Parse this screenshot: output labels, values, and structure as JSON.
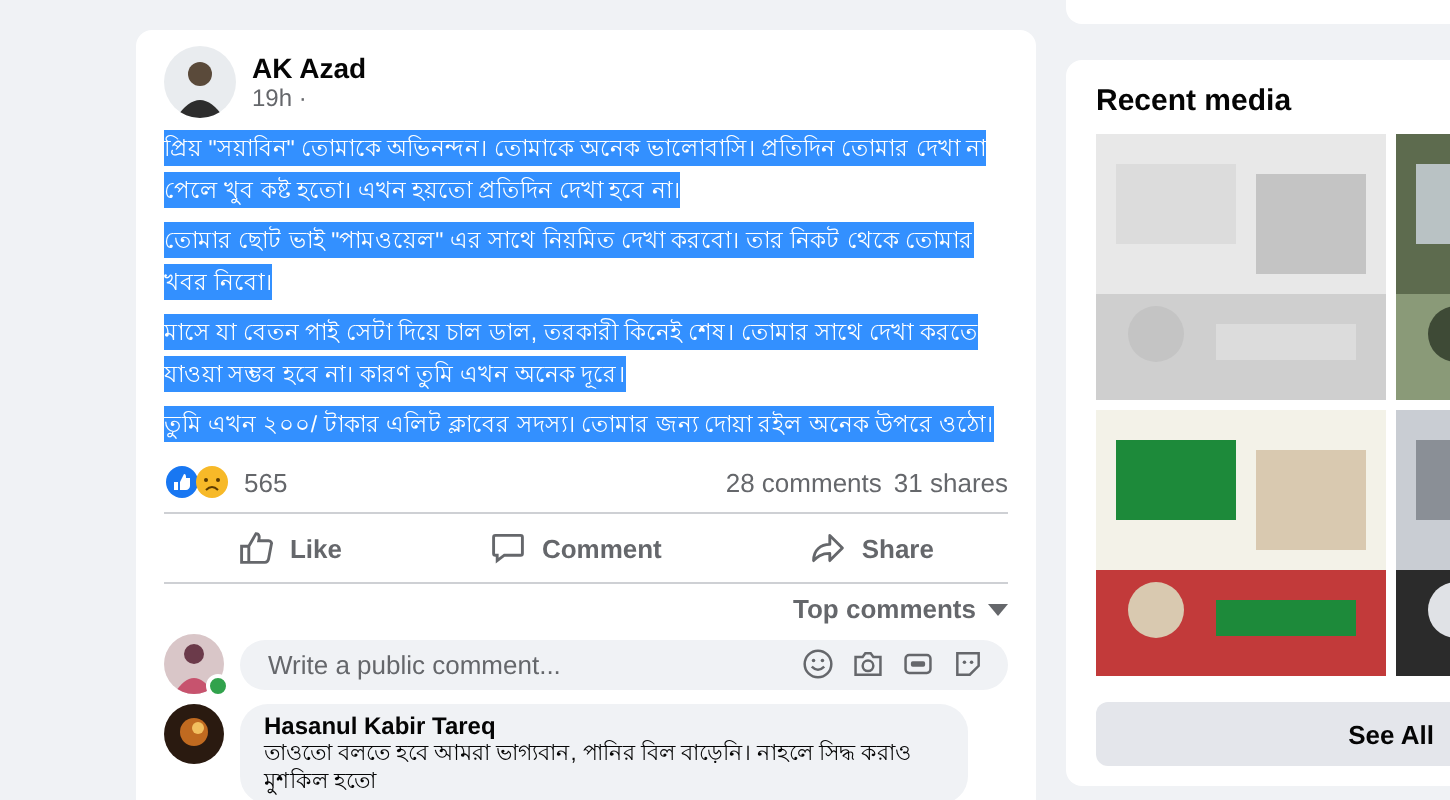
{
  "post": {
    "author": "AK Azad",
    "time": "19h ·",
    "text_selected": true,
    "paragraphs": [
      "প্রিয় \"সয়াবিন\" তোমাকে অভিনন্দন। তোমাকে অনেক ভালোবাসি। প্রতিদিন তোমার দেখা না পেলে খুব কষ্ট হতো। এখন হয়তো প্রতিদিন দেখা হবে না।",
      "তোমার ছোট ভাই \"পামওয়েল\" এর সাথে নিয়মিত দেখা করবো। তার নিকট থেকে তোমার খবর নিবো।",
      "মাসে যা বেতন পাই সেটা দিয়ে চাল ডাল, তরকারী কিনেই শেষ। তোমার সাথে দেখা করতে যাওয়া সম্ভব হবে না। কারণ তুমি এখন অনেক দূরে।",
      "তুমি এখন ২০০/ টাকার এলিট ক্লাবের সদস্য। তোমার জন্য দোয়া রইল অনেক উপরে ওঠো।"
    ],
    "reaction_count": "565",
    "comments_count": "28 comments",
    "shares_count": "31 shares",
    "actions": [
      {
        "kind": "like",
        "label": "Like"
      },
      {
        "kind": "comment",
        "label": "Comment"
      },
      {
        "kind": "share",
        "label": "Share"
      }
    ],
    "sort": "Top comments",
    "comment_input": {
      "placeholder": "Write a public comment...",
      "online": true
    },
    "comments": [
      {
        "author": "Hasanul Kabir Tareq",
        "text": "তাওতো বলতে হবে আমরা ভাগ্যবান, পানির বিল বাড়েনি। নাহলে সিদ্ধ করাও মুশকিল হতো"
      }
    ]
  },
  "recent_media": {
    "title": "Recent media",
    "button": "See All"
  }
}
